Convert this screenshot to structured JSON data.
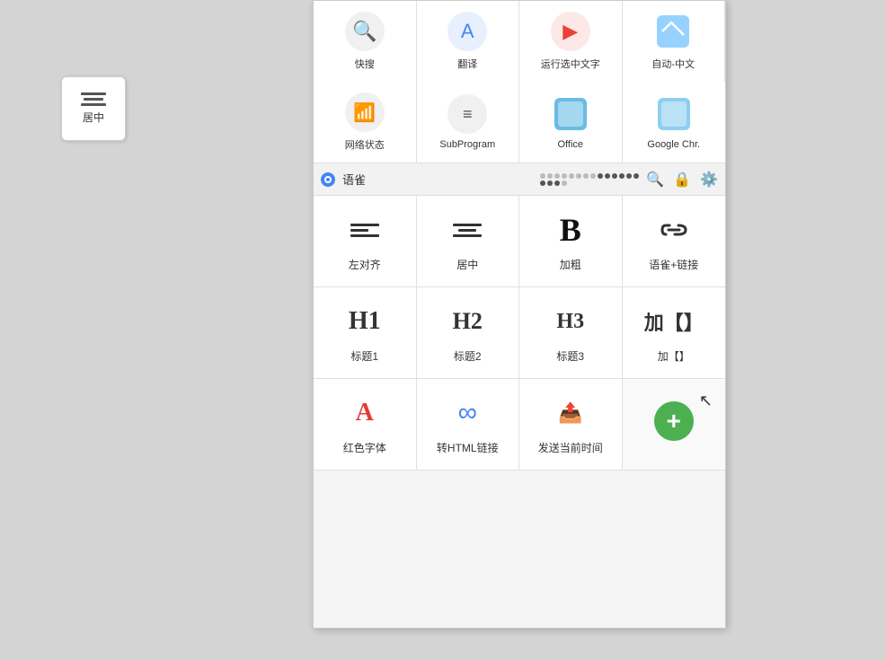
{
  "widget": {
    "label": "居中"
  },
  "topGrid": {
    "items": [
      {
        "id": "quick-search",
        "label": "快搜",
        "iconType": "search"
      },
      {
        "id": "translate",
        "label": "翻译",
        "iconType": "translate"
      },
      {
        "id": "run-chinese",
        "label": "运行选中文字",
        "iconType": "run"
      },
      {
        "id": "auto-chinese",
        "label": "自动-中文",
        "iconType": "auto"
      },
      {
        "id": "network-status",
        "label": "网络状态",
        "iconType": "network"
      },
      {
        "id": "sub-program",
        "label": "SubProgram",
        "iconType": "sub"
      },
      {
        "id": "office",
        "label": "Office",
        "iconType": "office"
      },
      {
        "id": "google-chrome",
        "label": "Google Chr.",
        "iconType": "chrome"
      }
    ]
  },
  "browser": {
    "favicon": "chrome",
    "title": "语雀",
    "dots": [
      0,
      0,
      0,
      0,
      0,
      0,
      0,
      0,
      1,
      1,
      1,
      1,
      1,
      1,
      1,
      1,
      1,
      0
    ],
    "icons": [
      "search",
      "lock",
      "settings"
    ]
  },
  "commands": {
    "row1": [
      {
        "id": "align-left",
        "label": "左对齐",
        "iconType": "align-left"
      },
      {
        "id": "align-center",
        "label": "居中",
        "iconType": "align-center"
      },
      {
        "id": "bold",
        "label": "加粗",
        "iconType": "bold"
      },
      {
        "id": "yuque-link",
        "label": "语雀+链接",
        "iconType": "link"
      }
    ],
    "row2": [
      {
        "id": "h1",
        "label": "标题1",
        "iconType": "h1"
      },
      {
        "id": "h2",
        "label": "标题2",
        "iconType": "h2"
      },
      {
        "id": "h3",
        "label": "标题3",
        "iconType": "h3"
      },
      {
        "id": "add-brackets",
        "label": "加【】",
        "iconType": "brackets"
      }
    ],
    "row3": [
      {
        "id": "red-font",
        "label": "红色字体",
        "iconType": "red-font"
      },
      {
        "id": "html-link",
        "label": "转HTML链接",
        "iconType": "infinite"
      },
      {
        "id": "send-time",
        "label": "发送当前时间",
        "iconType": "send-time"
      },
      {
        "id": "add-new",
        "label": "",
        "iconType": "plus"
      }
    ]
  }
}
